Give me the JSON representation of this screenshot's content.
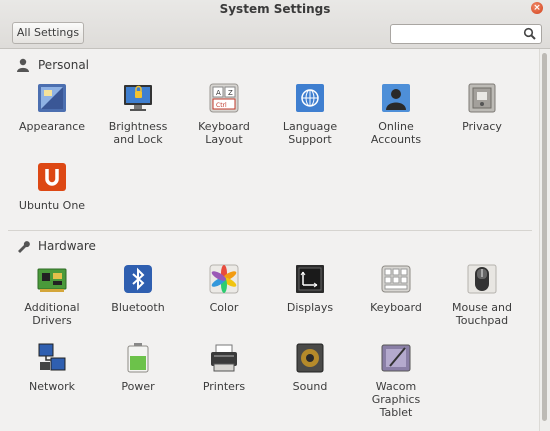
{
  "window": {
    "title": "System Settings"
  },
  "toolbar": {
    "all_settings_label": "All Settings",
    "search_placeholder": ""
  },
  "sections": {
    "personal": {
      "title": "Personal",
      "items": [
        "Appearance",
        "Brightness\nand Lock",
        "Keyboard\nLayout",
        "Language\nSupport",
        "Online\nAccounts",
        "Privacy",
        "Ubuntu One"
      ]
    },
    "hardware": {
      "title": "Hardware",
      "items": [
        "Additional\nDrivers",
        "Bluetooth",
        "Color",
        "Displays",
        "Keyboard",
        "Mouse and\nTouchpad",
        "Network",
        "Power",
        "Printers",
        "Sound",
        "Wacom\nGraphics\nTablet"
      ]
    }
  },
  "icons": {
    "appearance": "appearance-icon",
    "brightness": "monitor-lock-icon",
    "keyboard_layout": "keyboard-layout-icon",
    "language": "un-flag-icon",
    "online_accounts": "person-icon",
    "privacy": "safe-icon",
    "ubuntu_one": "ubuntu-one-icon",
    "drivers": "circuit-board-icon",
    "bluetooth": "bluetooth-icon",
    "color": "color-wheel-icon",
    "displays": "display-icon",
    "keyboard": "keyboard-icon",
    "mouse": "mouse-icon",
    "network": "network-icon",
    "power": "battery-icon",
    "printers": "printer-icon",
    "sound": "speaker-icon",
    "wacom": "tablet-icon"
  },
  "colors": {
    "accent": "#dd4814",
    "window_bg": "#f2f1f0"
  }
}
